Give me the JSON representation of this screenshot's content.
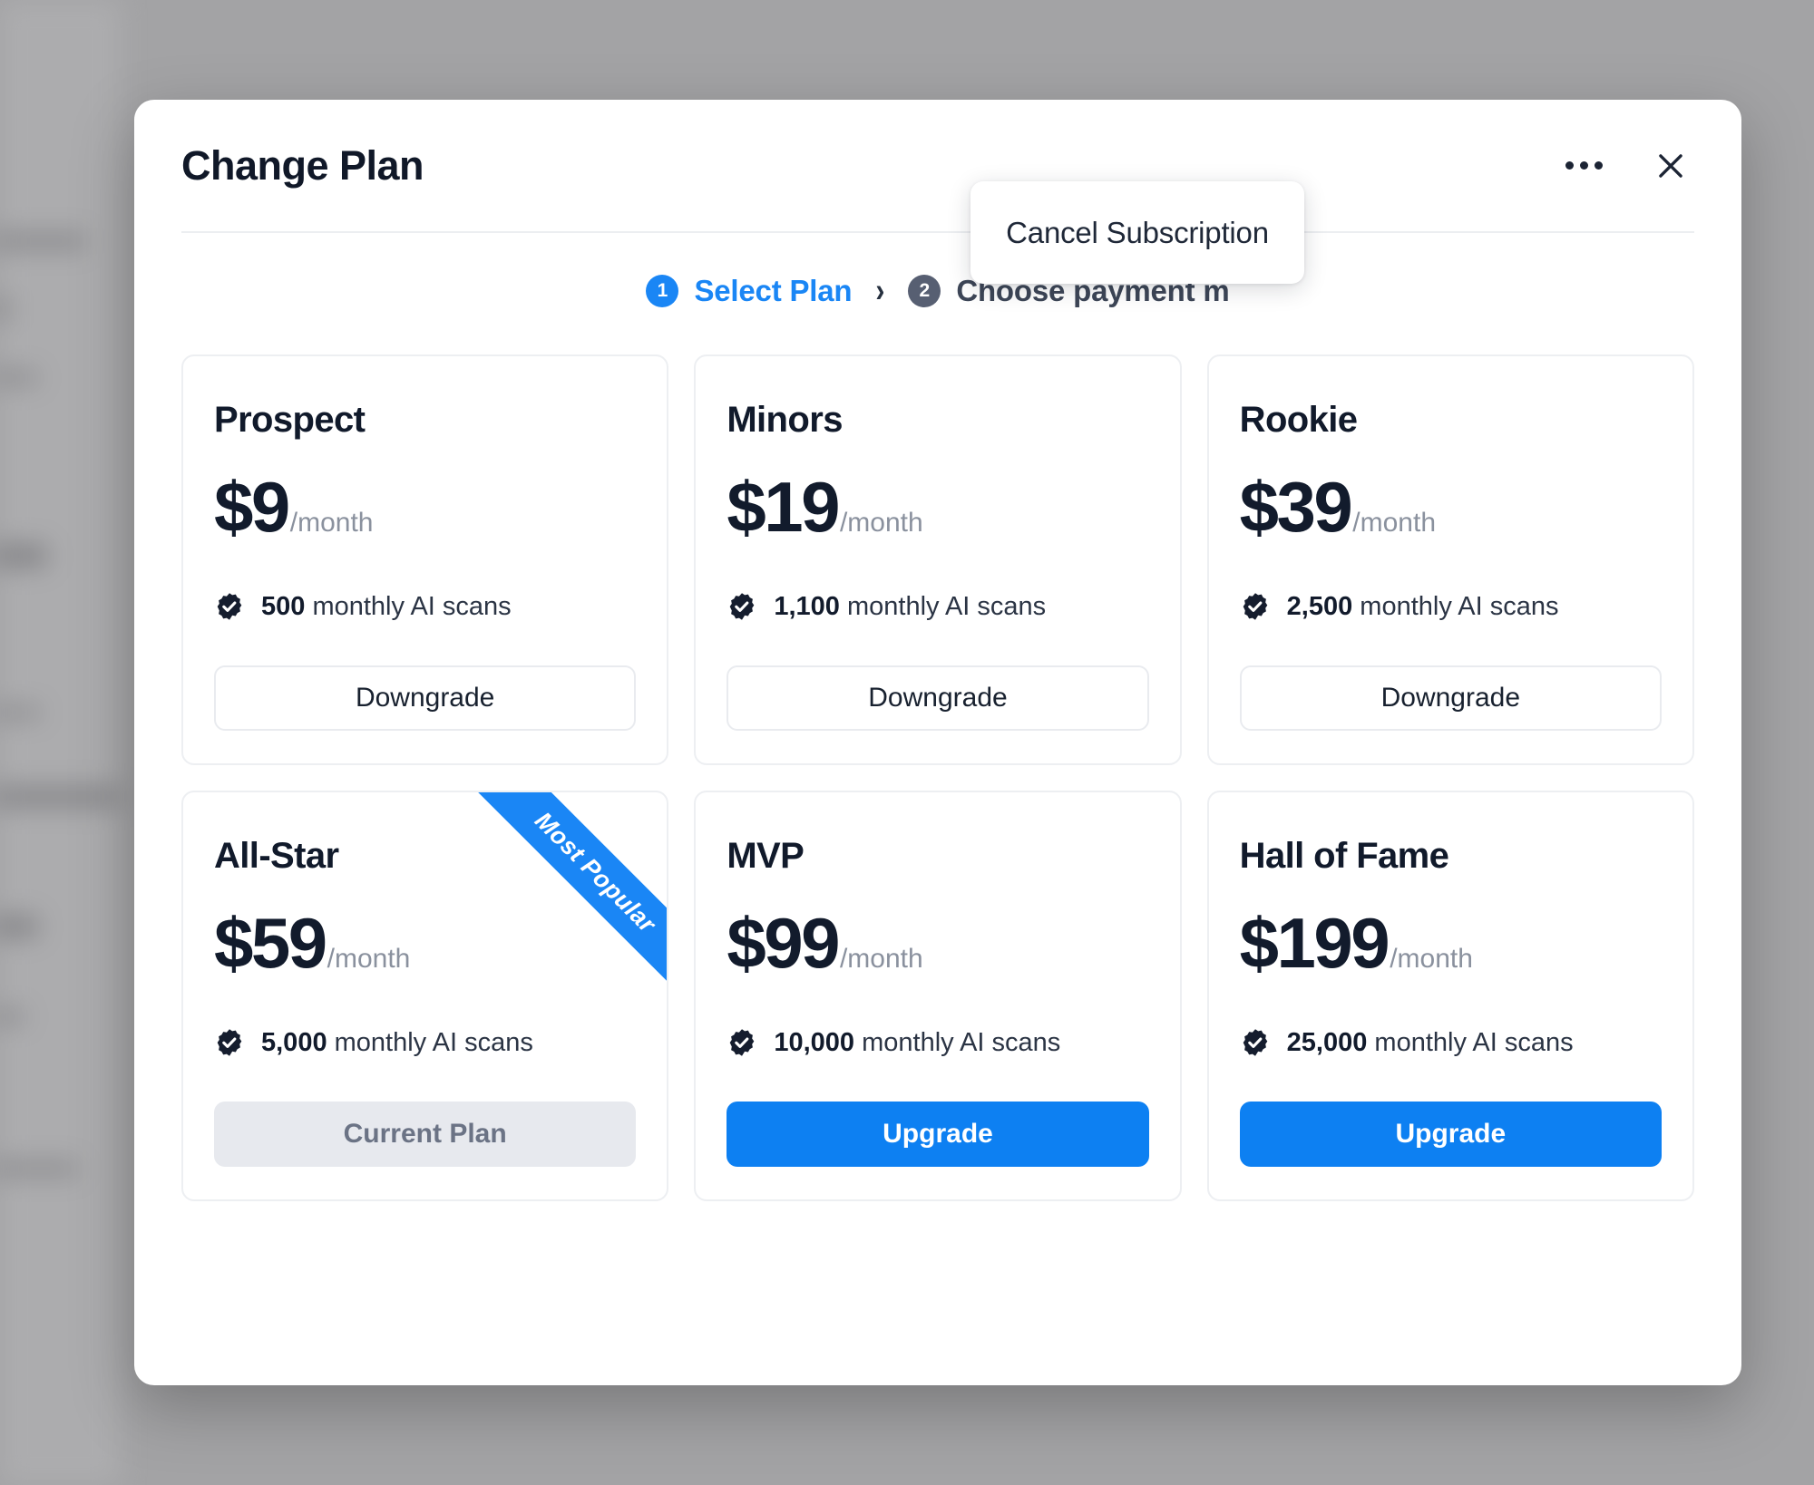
{
  "modal": {
    "title": "Change Plan",
    "more_icon": "ellipsis-icon",
    "close_icon": "close-icon"
  },
  "menu": {
    "items": [
      {
        "label": "Cancel Subscription"
      }
    ]
  },
  "stepper": {
    "separator": "›",
    "steps": [
      {
        "number": "1",
        "label": "Select Plan",
        "state": "active"
      },
      {
        "number": "2",
        "label": "Choose payment m",
        "state": "inactive"
      }
    ]
  },
  "colors": {
    "accent_blue": "#0d80f2",
    "step_active_blue": "#1a86f5",
    "step_inactive_gray": "#575f72",
    "text_dark": "#121b2c",
    "muted_text": "#8a919e",
    "disabled_bg": "#e7e9ee",
    "card_border": "#edeff2",
    "overlay_gray": "#a3a3a5"
  },
  "plans": [
    {
      "name": "Prospect",
      "price": "$9",
      "period": "/month",
      "feature_count": "500",
      "feature_text": "monthly AI scans",
      "feature_icon": "check-circle-icon",
      "button_label": "Downgrade",
      "button_style": "outline",
      "ribbon": null
    },
    {
      "name": "Minors",
      "price": "$19",
      "period": "/month",
      "feature_count": "1,100",
      "feature_text": "monthly AI scans",
      "feature_icon": "check-circle-icon",
      "button_label": "Downgrade",
      "button_style": "outline",
      "ribbon": null
    },
    {
      "name": "Rookie",
      "price": "$39",
      "period": "/month",
      "feature_count": "2,500",
      "feature_text": "monthly AI scans",
      "feature_icon": "check-circle-icon",
      "button_label": "Downgrade",
      "button_style": "outline",
      "ribbon": null
    },
    {
      "name": "All-Star",
      "price": "$59",
      "period": "/month",
      "feature_count": "5,000",
      "feature_text": "monthly AI scans",
      "feature_icon": "check-circle-icon",
      "button_label": "Current Plan",
      "button_style": "disabled",
      "ribbon": "Most Popular"
    },
    {
      "name": "MVP",
      "price": "$99",
      "period": "/month",
      "feature_count": "10,000",
      "feature_text": "monthly AI scans",
      "feature_icon": "check-circle-icon",
      "button_label": "Upgrade",
      "button_style": "primary",
      "ribbon": null
    },
    {
      "name": "Hall of Fame",
      "price": "$199",
      "period": "/month",
      "feature_count": "25,000",
      "feature_text": "monthly AI scans",
      "feature_icon": "check-circle-icon",
      "button_label": "Upgrade",
      "button_style": "primary",
      "ribbon": null
    }
  ]
}
